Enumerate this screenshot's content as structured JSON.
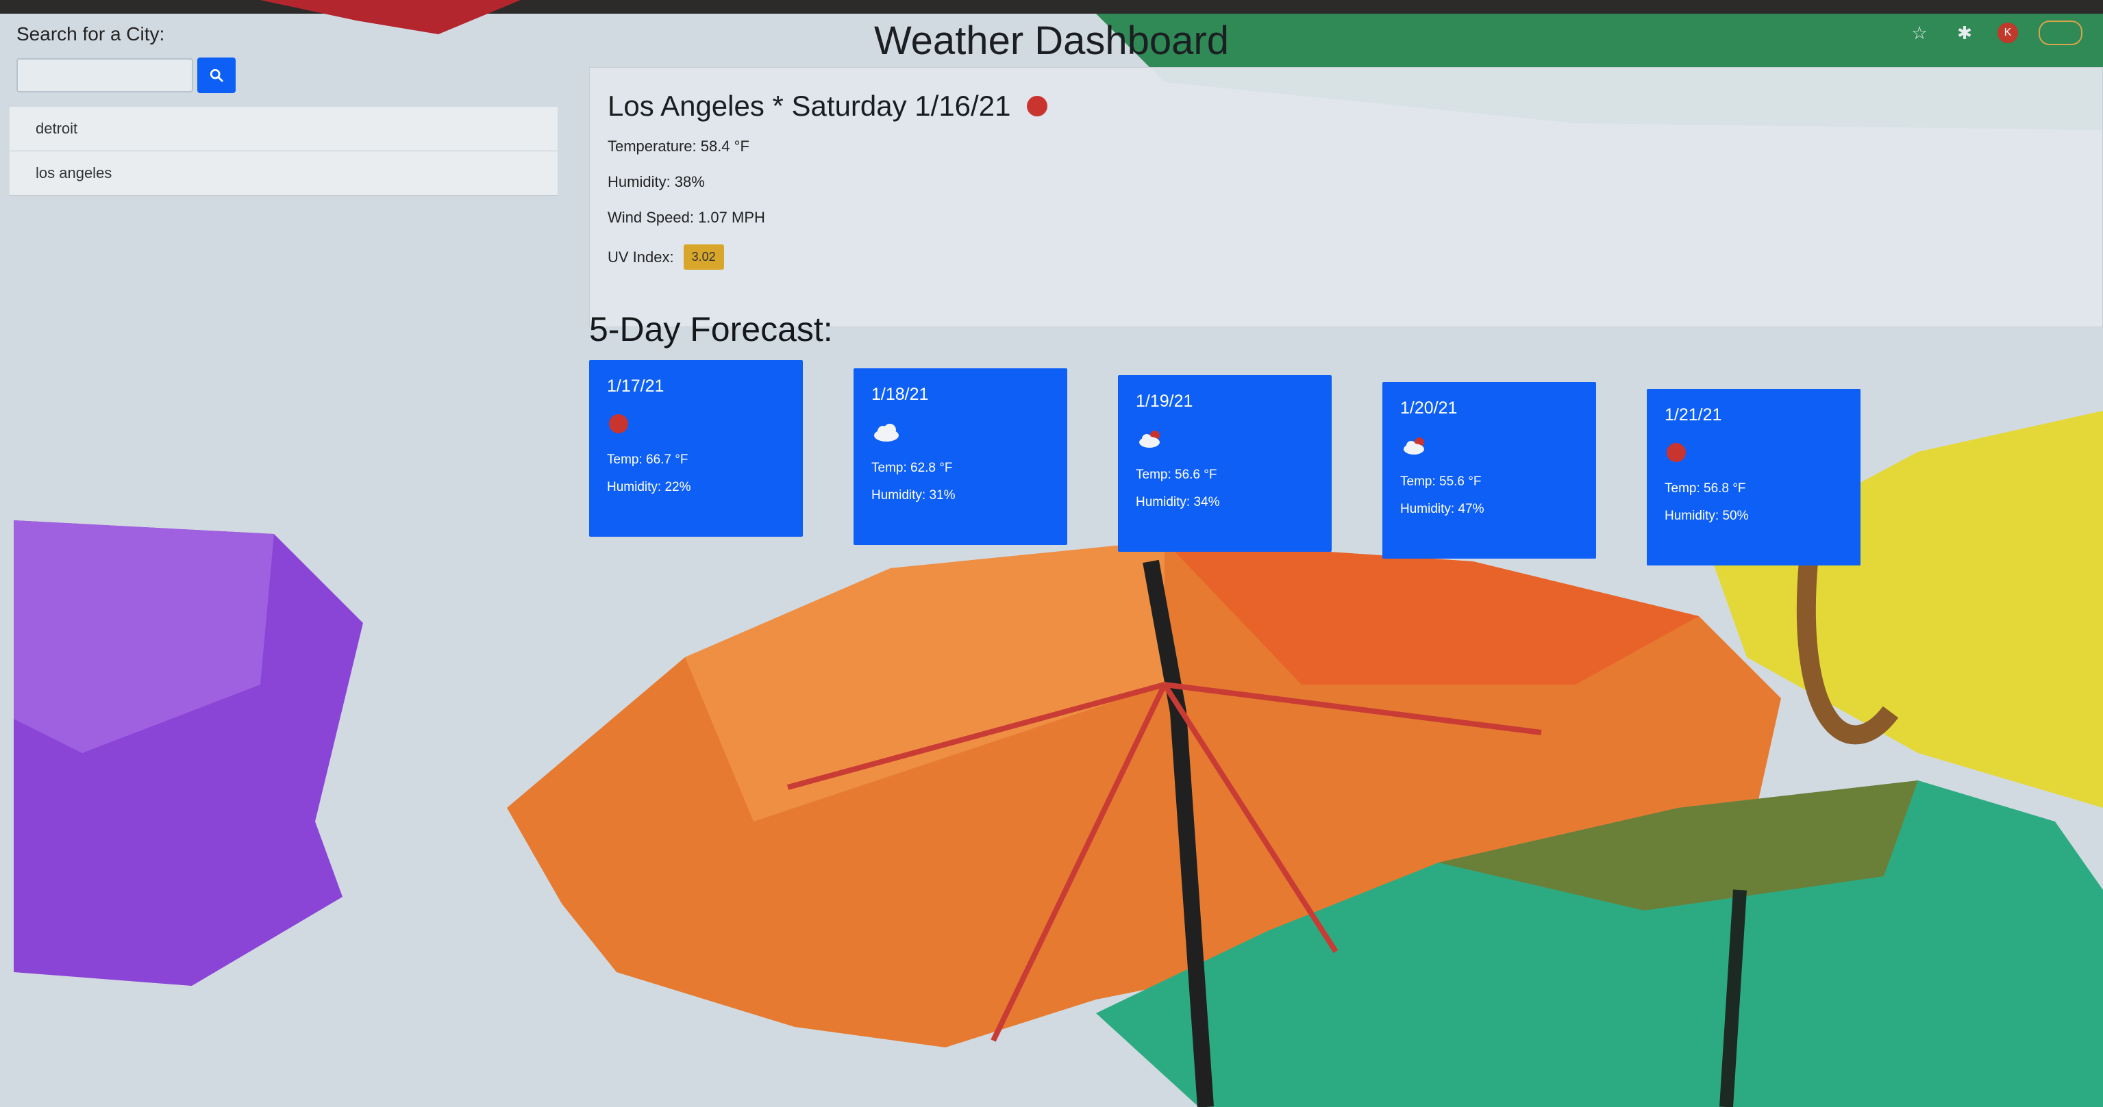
{
  "header": {
    "title": "Weather Dashboard"
  },
  "sidebar": {
    "search_label": "Search for a City:",
    "search_value": "",
    "search_button_icon": "search-icon",
    "history": [
      {
        "label": "detroit"
      },
      {
        "label": "los angeles"
      }
    ]
  },
  "current": {
    "title": "Los Angeles * Saturday 1/16/21",
    "icon": "clear-sky-icon",
    "temperature": "Temperature: 58.4 °F",
    "humidity": "Humidity: 38%",
    "wind": "Wind Speed: 1.07 MPH",
    "uv_label": "UV Index:",
    "uv_value": "3.02",
    "uv_color": "#d8a62b"
  },
  "forecast": {
    "heading": "5-Day Forecast:",
    "days": [
      {
        "date": "1/17/21",
        "icon": "clear-sky-icon",
        "temp": "Temp: 66.7 °F",
        "humidity": "Humidity: 22%"
      },
      {
        "date": "1/18/21",
        "icon": "cloud-icon",
        "temp": "Temp: 62.8 °F",
        "humidity": "Humidity: 31%"
      },
      {
        "date": "1/19/21",
        "icon": "partly-cloudy-icon",
        "temp": "Temp: 56.6 °F",
        "humidity": "Humidity: 34%"
      },
      {
        "date": "1/20/21",
        "icon": "partly-cloudy-icon",
        "temp": "Temp: 55.6 °F",
        "humidity": "Humidity: 47%"
      },
      {
        "date": "1/21/21",
        "icon": "clear-sky-icon",
        "temp": "Temp: 56.8 °F",
        "humidity": "Humidity: 50%"
      }
    ]
  },
  "browser_toolbar": {
    "profile_initial": "K"
  },
  "colors": {
    "card_blue": "#0d5ff6",
    "sun_red": "#c9342f"
  }
}
